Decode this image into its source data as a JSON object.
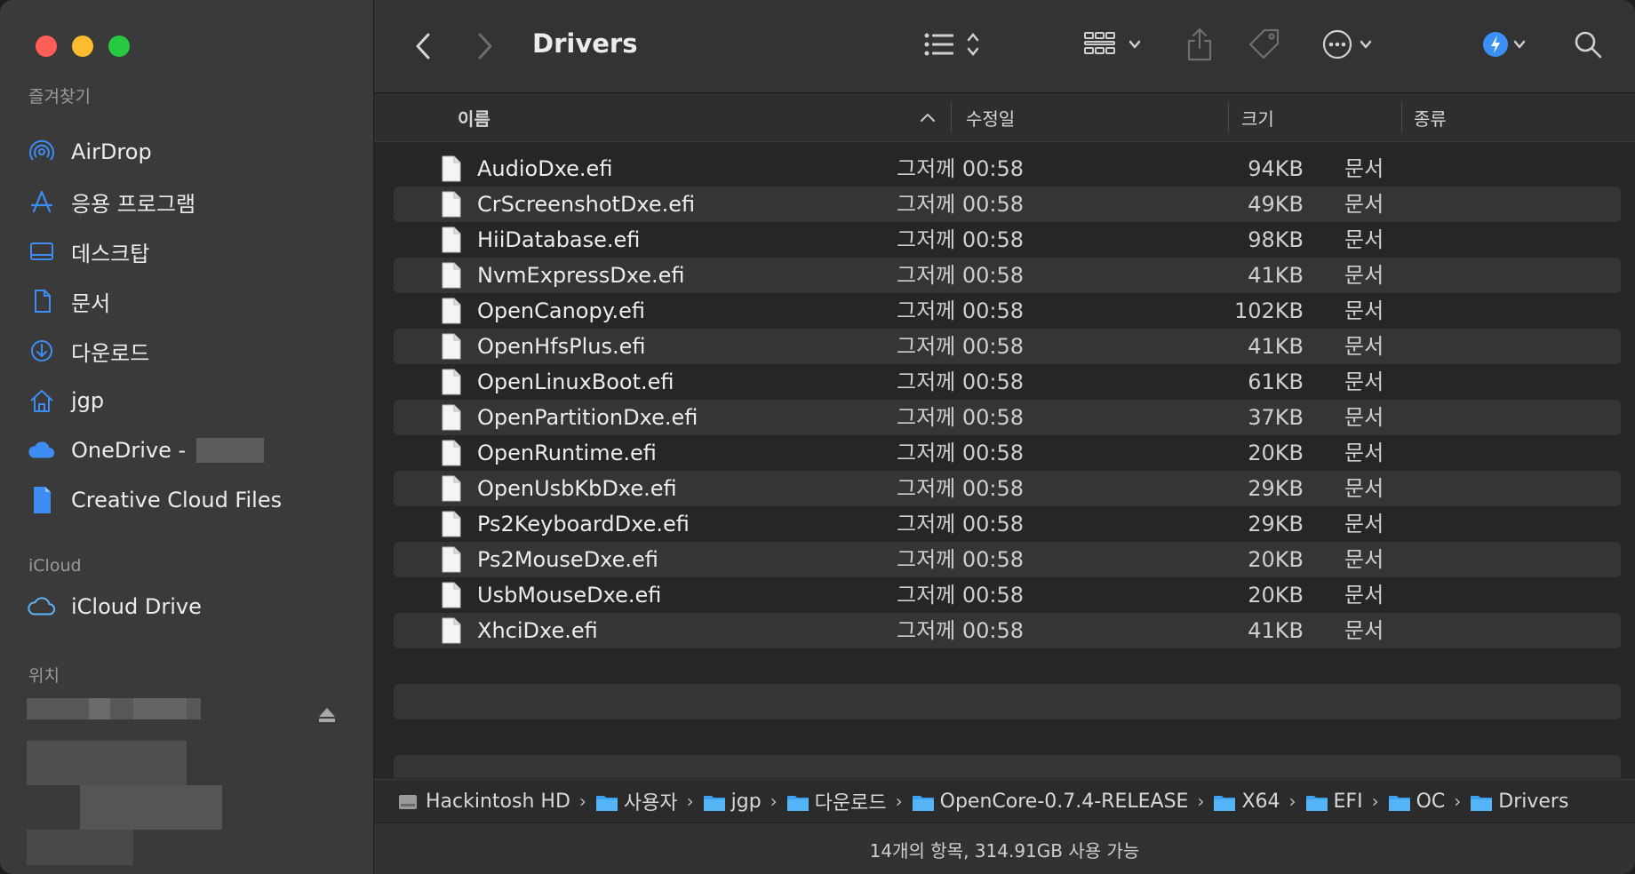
{
  "window_title": "Drivers",
  "sidebar": {
    "favorites_label": "즐겨찾기",
    "favorites": [
      {
        "label": "AirDrop",
        "icon": "airdrop-icon"
      },
      {
        "label": "응용 프로그램",
        "icon": "applications-icon"
      },
      {
        "label": "데스크탑",
        "icon": "desktop-icon"
      },
      {
        "label": "문서",
        "icon": "document-icon"
      },
      {
        "label": "다운로드",
        "icon": "download-icon"
      },
      {
        "label": "jgp",
        "icon": "home-icon"
      },
      {
        "label": "OneDrive - ",
        "icon": "cloud-icon"
      },
      {
        "label": "Creative Cloud Files",
        "icon": "file-icon"
      }
    ],
    "icloud_label": "iCloud",
    "icloud_items": [
      {
        "label": "iCloud Drive",
        "icon": "icloud-icon"
      }
    ],
    "locations_label": "위치"
  },
  "columns": {
    "name": "이름",
    "date": "수정일",
    "size": "크기",
    "kind": "종류"
  },
  "files": [
    {
      "name": "AudioDxe.efi",
      "date": "그저께 00:58",
      "size": "94KB",
      "kind": "문서"
    },
    {
      "name": "CrScreenshotDxe.efi",
      "date": "그저께 00:58",
      "size": "49KB",
      "kind": "문서"
    },
    {
      "name": "HiiDatabase.efi",
      "date": "그저께 00:58",
      "size": "98KB",
      "kind": "문서"
    },
    {
      "name": "NvmExpressDxe.efi",
      "date": "그저께 00:58",
      "size": "41KB",
      "kind": "문서"
    },
    {
      "name": "OpenCanopy.efi",
      "date": "그저께 00:58",
      "size": "102KB",
      "kind": "문서"
    },
    {
      "name": "OpenHfsPlus.efi",
      "date": "그저께 00:58",
      "size": "41KB",
      "kind": "문서"
    },
    {
      "name": "OpenLinuxBoot.efi",
      "date": "그저께 00:58",
      "size": "61KB",
      "kind": "문서"
    },
    {
      "name": "OpenPartitionDxe.efi",
      "date": "그저께 00:58",
      "size": "37KB",
      "kind": "문서"
    },
    {
      "name": "OpenRuntime.efi",
      "date": "그저께 00:58",
      "size": "20KB",
      "kind": "문서"
    },
    {
      "name": "OpenUsbKbDxe.efi",
      "date": "그저께 00:58",
      "size": "29KB",
      "kind": "문서"
    },
    {
      "name": "Ps2KeyboardDxe.efi",
      "date": "그저께 00:58",
      "size": "29KB",
      "kind": "문서"
    },
    {
      "name": "Ps2MouseDxe.efi",
      "date": "그저께 00:58",
      "size": "20KB",
      "kind": "문서"
    },
    {
      "name": "UsbMouseDxe.efi",
      "date": "그저께 00:58",
      "size": "20KB",
      "kind": "문서"
    },
    {
      "name": "XhciDxe.efi",
      "date": "그저께 00:58",
      "size": "41KB",
      "kind": "문서"
    }
  ],
  "path": [
    {
      "label": "Hackintosh HD",
      "icon": "disk-icon"
    },
    {
      "label": "사용자",
      "icon": "folder-icon"
    },
    {
      "label": "jgp",
      "icon": "home-folder-icon"
    },
    {
      "label": "다운로드",
      "icon": "download-folder-icon"
    },
    {
      "label": "OpenCore-0.7.4-RELEASE",
      "icon": "folder-icon"
    },
    {
      "label": "X64",
      "icon": "folder-icon"
    },
    {
      "label": "EFI",
      "icon": "folder-icon"
    },
    {
      "label": "OC",
      "icon": "folder-icon"
    },
    {
      "label": "Drivers",
      "icon": "folder-icon"
    }
  ],
  "status": "14개의 항목, 314.91GB 사용 가능",
  "colors": {
    "accent": "#3b8ff6",
    "sidebar_icon": "#3d8df5"
  }
}
